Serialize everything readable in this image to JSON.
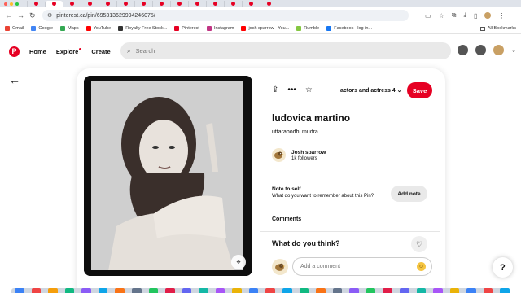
{
  "browser": {
    "url": "pinterest.ca/pin/695313629994246075/",
    "tab_count": 14,
    "bookmarks": [
      {
        "label": "Gmail",
        "color": "#ea4335"
      },
      {
        "label": "Google",
        "color": "#4285f4"
      },
      {
        "label": "Maps",
        "color": "#34a853"
      },
      {
        "label": "YouTube",
        "color": "#ff0000"
      },
      {
        "label": "Royalty Free Stock...",
        "color": "#333333"
      },
      {
        "label": "Pinterest",
        "color": "#e60023"
      },
      {
        "label": "Instagram",
        "color": "#c13584"
      },
      {
        "label": "josh sparrow - You...",
        "color": "#ff0000"
      },
      {
        "label": "Rumble",
        "color": "#85c742"
      },
      {
        "label": "Facebook - log in...",
        "color": "#1877f2"
      }
    ],
    "all_bookmarks": "All Bookmarks"
  },
  "header": {
    "logo": "P",
    "home": "Home",
    "explore": "Explore",
    "create": "Create",
    "search_placeholder": "Search"
  },
  "pin": {
    "board": "actors and actress 4",
    "save": "Save",
    "title": "ludovica martino",
    "description": "uttarabodhi mudra",
    "creator_name": "Josh sparrow",
    "creator_followers": "1k followers",
    "note_title": "Note to self",
    "note_subtitle": "What do you want to remember about this Pin?",
    "add_note": "Add note",
    "comments_label": "Comments",
    "prompt": "What do you think?",
    "comment_placeholder": "Add a comment"
  },
  "help": "?",
  "colors": {
    "brand": "#e60023",
    "search_bg": "#e9e9e9"
  }
}
